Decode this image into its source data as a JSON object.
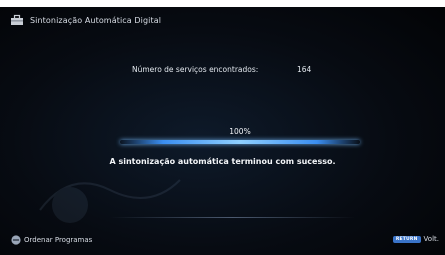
{
  "header": {
    "title": "Sintonização Automática Digital",
    "icon": "toolbox-icon"
  },
  "scan": {
    "services_label": "Número de serviços encontrados:",
    "services_count": "164",
    "progress_label": "100%",
    "progress_value": 1.0,
    "result_message": "A sintonização automática terminou com sucesso."
  },
  "footer": {
    "options_icon": "options-button-icon",
    "options_label": "Ordenar Programas",
    "return_key_label": "RETURN",
    "return_label": "Volt."
  },
  "colors": {
    "accent": "#3b8ef0",
    "return_key": "#3a74c9",
    "background": "#070b12"
  }
}
